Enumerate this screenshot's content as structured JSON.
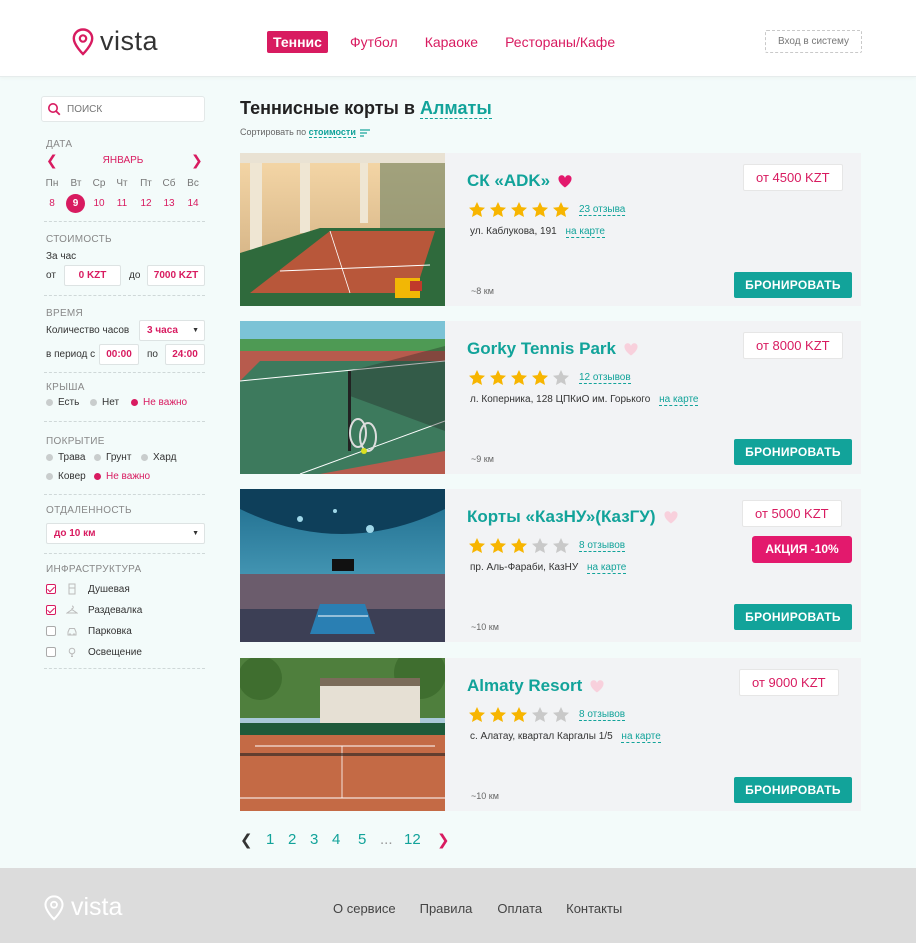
{
  "brand": {
    "name": "vista",
    "accent": "#d81b60",
    "teal": "#12a39a"
  },
  "nav": {
    "items": [
      {
        "label": "Теннис",
        "active": true
      },
      {
        "label": "Футбол",
        "active": false
      },
      {
        "label": "Караоке",
        "active": false
      },
      {
        "label": "Рестораны/Кафе",
        "active": false
      }
    ],
    "login_label": "Вход в систему"
  },
  "sidebar": {
    "search_placeholder": "поиск",
    "date": {
      "title": "Дата",
      "month": "ЯНВАРЬ",
      "weekdays": [
        "Пн",
        "Вт",
        "Ср",
        "Чт",
        "Пт",
        "Сб",
        "Вс"
      ],
      "days": [
        "8",
        "9",
        "10",
        "11",
        "12",
        "13",
        "14"
      ],
      "selected_day": "9"
    },
    "cost": {
      "title": "Стоимость",
      "per_hour": "За час",
      "from_label": "от",
      "from_value": "0 KZT",
      "to_label": "до",
      "to_value": "7000 KZT"
    },
    "time": {
      "title": "Время",
      "hours_label": "Количество часов",
      "hours_value": "3 часа",
      "period_label": "в период с",
      "period_from": "00:00",
      "period_to_label": "по",
      "period_to": "24:00"
    },
    "roof": {
      "title": "Крыша",
      "options": [
        {
          "label": "Есть",
          "selected": false
        },
        {
          "label": "Нет",
          "selected": false
        },
        {
          "label": "Не важно",
          "selected": true
        }
      ]
    },
    "surface": {
      "title": "Покрытие",
      "options": [
        {
          "label": "Трава",
          "selected": false
        },
        {
          "label": "Грунт",
          "selected": false
        },
        {
          "label": "Хард",
          "selected": false
        },
        {
          "label": "Ковер",
          "selected": false
        },
        {
          "label": "Не важно",
          "selected": true
        }
      ]
    },
    "distance": {
      "title": "Отдаленность",
      "value": "до 10 км"
    },
    "infrastructure": {
      "title": "Инфраструктура",
      "items": [
        {
          "label": "Душевая",
          "checked": true,
          "icon": "shower-icon"
        },
        {
          "label": "Раздевалка",
          "checked": true,
          "icon": "hanger-icon"
        },
        {
          "label": "Парковка",
          "checked": false,
          "icon": "car-icon"
        },
        {
          "label": "Освещение",
          "checked": false,
          "icon": "lightbulb-icon"
        }
      ]
    }
  },
  "main": {
    "title_prefix": "Теннисные корты в",
    "city": "Алматы",
    "sort_prefix": "Сортировать по",
    "sort_value": "стоимости",
    "book_label": "БРОНИРОВАТЬ",
    "map_label": "на карте",
    "courts": [
      {
        "name": "СК «ADK»",
        "favorite": true,
        "rating": 5,
        "reviews": "23 отзыва",
        "address": "ул. Каблукова, 191",
        "distance": "~8 км",
        "price": "от 4500 KZT",
        "promo": ""
      },
      {
        "name": "Gorky Tennis Park",
        "favorite": false,
        "rating": 4,
        "reviews": "12 отзывов",
        "address": "л. Коперника, 128 ЦПКиО им. Горького",
        "distance": "~9 км",
        "price": "от 8000 KZT",
        "promo": ""
      },
      {
        "name": "Корты «КазНУ»(КазГУ)",
        "favorite": false,
        "rating": 3,
        "reviews": "8 отзывов",
        "address": "пр. Аль-Фараби, КазНУ",
        "distance": "~10 км",
        "price": "от 5000 KZT",
        "promo": "АКЦИЯ -10%"
      },
      {
        "name": "Almaty Resort",
        "favorite": false,
        "rating": 3,
        "reviews": "8 отзывов",
        "address": "с. Алатау, квартал Каргалы 1/5",
        "distance": "~10 км",
        "price": "от 9000 KZT",
        "promo": ""
      }
    ],
    "pagination": {
      "pages": [
        "1",
        "2",
        "3",
        "4",
        "5",
        "...",
        "12"
      ]
    }
  },
  "footer": {
    "brand": "vista",
    "links": [
      "О сервисе",
      "Правила",
      "Оплата",
      "Контакты"
    ]
  }
}
